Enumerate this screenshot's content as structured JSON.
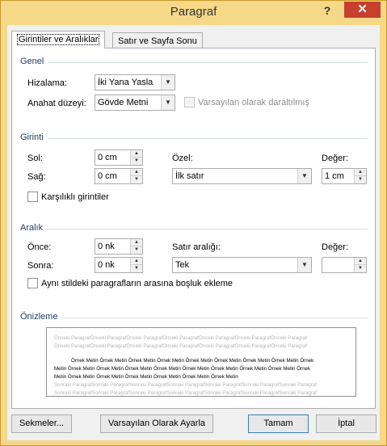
{
  "dialog": {
    "title": "Paragraf",
    "help_label": "?",
    "close_label": "✕"
  },
  "tabs": [
    {
      "label": "Girintiler ve Aralıklar",
      "active": true
    },
    {
      "label": "Satır ve Sayfa Sonu",
      "active": false
    }
  ],
  "general": {
    "header": "Genel",
    "alignment_label": "Hizalama:",
    "alignment_value": "İki Yana Yasla",
    "outline_label": "Anahat düzeyi:",
    "outline_value": "Gövde Metni",
    "collapsed_label": "Varsayılan olarak daraltılmış"
  },
  "indentation": {
    "header": "Girinti",
    "left_label": "Sol:",
    "left_value": "0 cm",
    "right_label": "Sağ:",
    "right_value": "0 cm",
    "special_label": "Özel:",
    "special_value": "İlk satır",
    "by_label": "Değer:",
    "by_value": "1 cm",
    "mirror_label": "Karşılıklı girintiler"
  },
  "spacing": {
    "header": "Aralık",
    "before_label": "Önce:",
    "before_value": "0 nk",
    "after_label": "Sonra:",
    "after_value": "0 nk",
    "line_label": "Satır aralığı:",
    "line_value": "Tek",
    "at_label": "Değer:",
    "at_value": "",
    "no_space_label": "Aynı stildeki paragrafların arasına boşluk ekleme"
  },
  "preview": {
    "header": "Önizleme",
    "prev1": "Önceki ParagrafÖnceki ParagrafÖnceki ParagrafÖnceki ParagrafÖnceki ParagrafÖnceki ParagrafÖnceki Paragraf",
    "prev2": "Önceki ParagrafÖnceki ParagrafÖnceki ParagrafÖnceki ParagrafÖnceki ParagrafÖnceki ParagrafÖnceki Paragraf",
    "sample1": "Örnek Metin Örnek Metin Örnek Metin Örnek Metin Örnek Metin Örnek Metin Örnek Metin Örnek Metin Örnek",
    "sample2": "Metin Örnek Metin Örnek Metin Örnek Metin Örnek Metin Örnek Metin Örnek Metin Örnek Metin Örnek Metin Örnek",
    "sample3": "Metin Örnek Metin Örnek Metin Örnek Metin Örnek Metin Örnek Metin Örnek Metin",
    "next1": "Sonraki ParagrafSonraki ParagrafSonraki ParagrafSonraki ParagrafSonraki ParagrafSonraki ParagrafSonraki Paragraf",
    "next2": "Sonraki ParagrafSonraki ParagrafSonraki ParagrafSonraki ParagrafSonraki ParagrafSonraki ParagrafSonraki Paragraf"
  },
  "buttons": {
    "tabs": "Sekmeler...",
    "default": "Varsayılan Olarak Ayarla",
    "ok": "Tamam",
    "cancel": "İptal"
  },
  "colors": {
    "title_bar": "#f5d888",
    "close_button": "#c7402d",
    "group_header": "#1e395b"
  }
}
